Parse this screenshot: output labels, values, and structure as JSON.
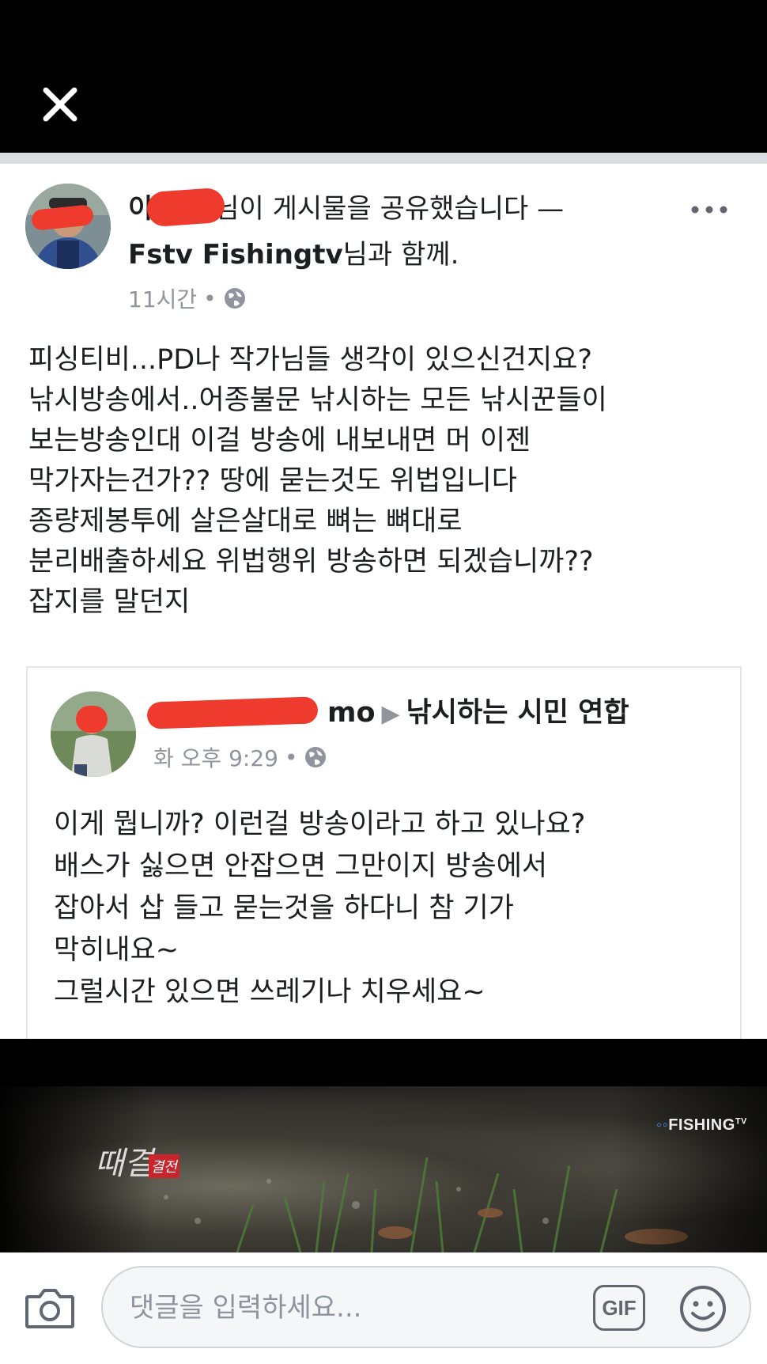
{
  "post": {
    "author_prefix": "이",
    "header_line1_rest": "님이 게시물을 공유했습니다 —",
    "header_line2_bold": "Fstv Fishingtv",
    "header_line2_rest": "님과 함께.",
    "time": "11시간",
    "dot": "•",
    "body_lines": [
      "피싱티비...PD나 작가님들 생각이 있으신건지요?",
      "낚시방송에서..어종불문 낚시하는 모든 낚시꾼들이",
      "보는방송인대 이걸 방송에 내보내면 머 이젠",
      "막가자는건가?? 땅에 묻는것도 위법입니다",
      "종량제봉투에 살은살대로 뼈는 뼈대로",
      "분리배출하세요 위법행위 방송하면 되겠습니까??",
      "잡지를 말던지"
    ]
  },
  "shared_post": {
    "author_suffix": "mo",
    "arrow": "▶",
    "group": "낚시하는 시민 연합",
    "time": "화 오후 9:29",
    "dot": "•",
    "body_lines": [
      "이게 뭡니까? 이런걸 방송이라고 하고 있나요?",
      "배스가 싫으면 안잡으면 그만이지 방송에서",
      "잡아서 삽 들고 묻는것을 하다니 참 기가",
      "막히내요~",
      "그럴시간 있으면 쓰레기나 치우세요~"
    ]
  },
  "video": {
    "logo": "FISHING",
    "logo_sup": "TV",
    "title_art": "때결",
    "seal": "결전"
  },
  "comment_bar": {
    "placeholder": "댓글을 입력하세요...",
    "gif_label": "GIF"
  },
  "colors": {
    "redaction": "#ef3b2d",
    "meta_gray": "#90949c",
    "icon_gray": "#606770"
  }
}
